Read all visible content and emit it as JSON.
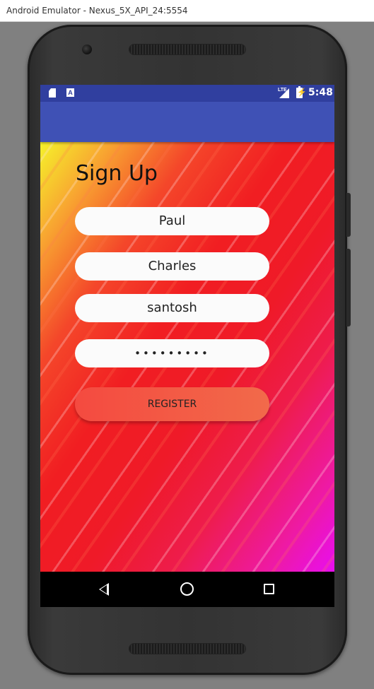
{
  "window": {
    "title": "Android Emulator - Nexus_5X_API_24:5554"
  },
  "status_bar": {
    "time": "5:48",
    "network": "LTE"
  },
  "signup": {
    "heading": "Sign Up",
    "fields": [
      {
        "name": "first-name-field",
        "value": "Paul"
      },
      {
        "name": "last-name-field",
        "value": "Charles"
      },
      {
        "name": "username-field",
        "value": "santosh"
      },
      {
        "name": "password-field",
        "value": "•••••••••"
      }
    ],
    "register_label": "REGISTER"
  },
  "colors": {
    "status_bar": "#303f9f",
    "app_bar": "#3f51b5",
    "register_button": "#f4534a"
  },
  "icons": {
    "status": [
      "sd-card-icon",
      "a-notification-icon",
      "lte-signal-icon",
      "battery-charging-icon"
    ],
    "navigation": [
      "back-icon",
      "home-icon",
      "recents-icon"
    ]
  }
}
